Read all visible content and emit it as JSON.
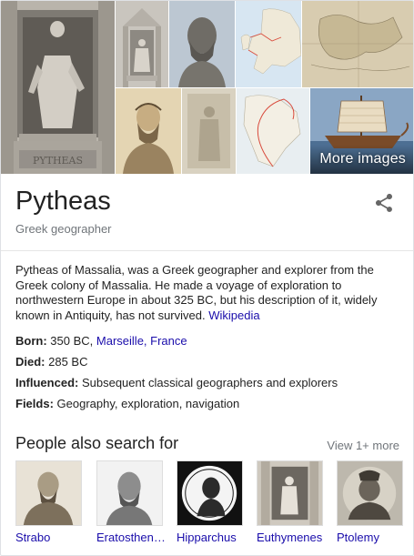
{
  "images": {
    "more_images_label": "More images",
    "items": [
      {
        "name": "statue-image",
        "alt": "Statue of Pytheas in niche"
      },
      {
        "name": "niche-statue-image",
        "alt": "Small statue in facade niche"
      },
      {
        "name": "bust-image",
        "alt": "Stone bust"
      },
      {
        "name": "europe-map-image",
        "alt": "Map of Europe"
      },
      {
        "name": "old-map-image",
        "alt": "Old map"
      },
      {
        "name": "engraving-image",
        "alt": "Bearded man engraving"
      },
      {
        "name": "stone-figure-image",
        "alt": "Stone relief figure"
      },
      {
        "name": "route-map-image",
        "alt": "Voyage route map"
      },
      {
        "name": "ship-image",
        "alt": "Ancient ship"
      }
    ],
    "statue_inscription": "PYTHEAS"
  },
  "entity": {
    "title": "Pytheas",
    "subtitle": "Greek geographer"
  },
  "description": {
    "text": "Pytheas of Massalia, was a Greek geographer and explorer from the Greek colony of Massalia. He made a voyage of exploration to northwestern Europe in about 325 BC, but his description of it, widely known in Antiquity, has not survived.",
    "source_link": "Wikipedia"
  },
  "facts": {
    "born_label": "Born:",
    "born_value": "350 BC,",
    "born_link": "Marseille, France",
    "died_label": "Died:",
    "died_value": "285 BC",
    "influenced_label": "Influenced:",
    "influenced_value": "Subsequent classical geographers and explorers",
    "fields_label": "Fields:",
    "fields_value": "Geography, exploration, navigation"
  },
  "people_also_search": {
    "title": "People also search for",
    "view_more": "View 1+ more",
    "people": [
      {
        "name": "Strabo"
      },
      {
        "name": "Eratosthenes"
      },
      {
        "name": "Hipparchus"
      },
      {
        "name": "Euthymenes"
      },
      {
        "name": "Ptolemy"
      }
    ]
  },
  "colors": {
    "link": "#1a0dab",
    "secondary_text": "#70757a",
    "border": "#dfe1e5"
  }
}
